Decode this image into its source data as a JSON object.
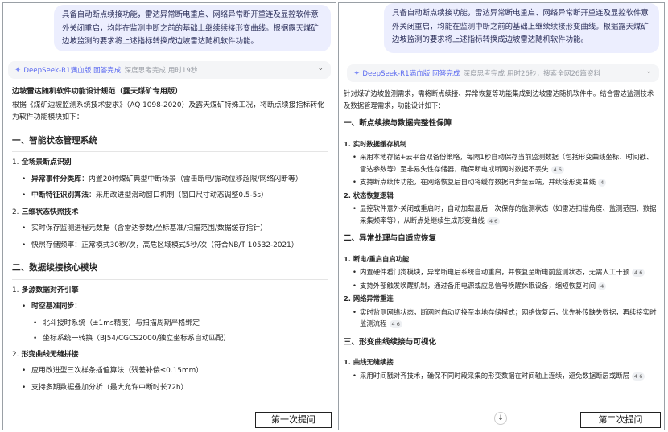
{
  "left": {
    "bubble": "具备自动断点续接功能，雷达异常断电重启、网络异常断开重连及显控软件意外关闭重启，均能在监测中断之前的基础上继续续接形变曲线。根据露天煤矿边坡监测的要求将上述指标转换成边坡雷达随机软件功能。",
    "thinking": {
      "label": "DeepSeek-R1满血版 回答完成",
      "status": "深度思考完成 用时19秒"
    },
    "doc_title": "边坡雷达随机软件功能设计规范（露天煤矿专用版）",
    "intro": "根据《煤矿边坡监测系统技术要求》（AQ 1098-2020）及露天煤矿特殊工况，将断点续接指标转化为软件功能模块如下：",
    "sec1": {
      "title": "一、智能状态管理系统",
      "s1": {
        "num": "1.",
        "title": "全场景断点识别"
      },
      "s1_items": [
        {
          "bold": "异常事件分类库",
          "text": "：内置20种煤矿典型中断场景（雷击断电/振动位移超限/网络闪断等）"
        },
        {
          "bold": "中断特征识别算法",
          "text": "：采用改进型滑动窗口机制（窗口尺寸动态调整0.5-5s）"
        }
      ],
      "s2": {
        "num": "2.",
        "title": "三维状态快照技术"
      },
      "s2_items": [
        {
          "text": "实时保存监测进程元数据（含雷达参数/坐标基准/扫描范围/数据缓存指针）"
        },
        {
          "text": "快照存储频率：正常模式30秒/次，高危区域模式5秒/次（符合NB/T 10532-2021）"
        }
      ]
    },
    "sec2": {
      "title": "二、数据续接核心模块",
      "s1": {
        "num": "1.",
        "title": "多源数据对齐引擎"
      },
      "sync": {
        "bold": "时空基准同步",
        "text": "："
      },
      "sync_items": [
        {
          "text": "北斗授时系统（±1ms精度）与扫描周期严格绑定"
        },
        {
          "text": "坐标系统一转换（BJ54/CGCS2000/独立坐标系自动匹配）"
        }
      ],
      "s2": {
        "num": "2.",
        "title": "形变曲线无缝拼接"
      },
      "s2_items": [
        {
          "text": "应用改进型三次样条插值算法（残差补偿≤0.15mm）"
        },
        {
          "text": "支持多期数据叠加分析（最大允许中断时长72h）"
        }
      ]
    },
    "tag": "第一次提问"
  },
  "right": {
    "bubble": "具备自动断点续接功能，雷达异常断电重启、网络异常断开重连及显控软件意外关闭重启，均能在监测中断之前的基础上继续续接形变曲线。根据露天煤矿边坡监测的要求将上述指标转换成边坡雷达随机软件功能。",
    "thinking": {
      "label": "DeepSeek-R1满血版 回答完成",
      "status": "深度思考完成 用时26秒，搜索全网26篇资料"
    },
    "intro": "针对煤矿边坡监测需求，需将断点续接、异常恢复等功能集成到边坡雷达随机软件中。结合雷达监测技术及数据管理需求，功能设计如下：",
    "sec1": {
      "title": "一、断点续接与数据完整性保障",
      "s1": {
        "num": "1.",
        "title": "实时数据缓存机制"
      },
      "s1_items": [
        {
          "text": "采用本地存储+云平台双备份策略，每隔1秒自动保存当前监测数据（包括形变曲线坐标、时间戳、雷达参数等）至非易失性存储器，确保断电或断网时数据不丢失",
          "cite": "4 6"
        },
        {
          "text": "支持断点续传功能，在网络恢复后自动将缓存数据同步至云端，并续接形变曲线",
          "cite": "4"
        }
      ],
      "s2": {
        "num": "2.",
        "title": "状态恢复逻辑"
      },
      "s2_items": [
        {
          "text": "显控软件意外关闭或重启时，自动加载最后一次保存的监测状态（如雷达扫描角度、监测范围、数据采集频率等），从断点处继续生成形变曲线",
          "cite": "4 6"
        }
      ]
    },
    "sec2": {
      "title": "二、异常处理与自适应恢复",
      "s1": {
        "num": "1.",
        "title": "断电/重启自启功能"
      },
      "s1_items": [
        {
          "text": "内置硬件看门狗模块，异常断电后系统自动重启，并恢复至断电前监测状态，无需人工干预",
          "cite": "4 6"
        },
        {
          "text": "支持外部触发唤醒机制，通过备用电源或应急信号唤醒休眠设备，缩短恢复时间",
          "cite": "4"
        }
      ],
      "s2": {
        "num": "2.",
        "title": "网络异常重连"
      },
      "s2_items": [
        {
          "text": "实时监测网络状态，断网时自动切换至本地存储模式；网络恢复后，优先补传缺失数据，再续接实时监测流程",
          "cite": "4 6"
        }
      ]
    },
    "sec3": {
      "title": "三、形变曲线续接与可视化",
      "s1": {
        "num": "1.",
        "title": "曲线无缝续接"
      },
      "s1_items": [
        {
          "text": "采用时间戳对齐技术，确保不同时段采集的形变数据在时间轴上连续，避免数据断层或断层",
          "cite": "4 6"
        }
      ]
    },
    "scroll_icon": "↓",
    "tag": "第二次提问"
  },
  "colors": {
    "bubble_bg": "#eceefe",
    "accent": "#5b6af0",
    "thinking_bg": "#f4f5f7"
  }
}
